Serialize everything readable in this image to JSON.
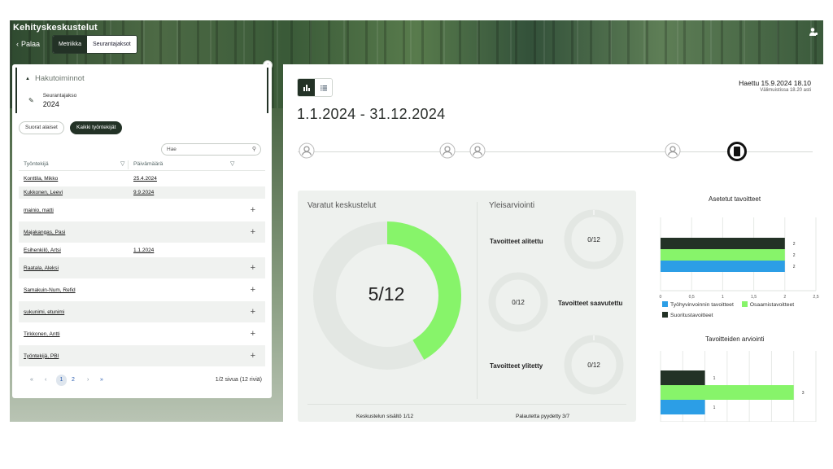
{
  "header": {
    "app_title": "Kehityskeskustelut",
    "back_label": "Palaa",
    "tabs": [
      {
        "label": "Metriikka",
        "active": true
      },
      {
        "label": "Seurantajaksot",
        "active": false
      }
    ],
    "user_icon": "user-icon"
  },
  "filters": {
    "title": "Hakutoiminnot",
    "period_label": "Seurantajakso",
    "period_value": "2024",
    "chips": [
      {
        "label": "Suorat alaiset",
        "active": false
      },
      {
        "label": "Kaikki työntekijät",
        "active": true
      }
    ],
    "search_placeholder": "Hae"
  },
  "table": {
    "columns": [
      "Työntekijä",
      "Päivämäärä"
    ],
    "rows": [
      {
        "name": "Konttila, Mikko",
        "date": "25.4.2024",
        "action": ""
      },
      {
        "name": "Kukkonen, Leevi",
        "date": "9.9.2024",
        "action": ""
      },
      {
        "name": "mainio, matti",
        "date": "",
        "action": "+"
      },
      {
        "name": "Majakangas, Pasi",
        "date": "",
        "action": "+"
      },
      {
        "name": "Esihenkilö, Artsi",
        "date": "1.1.2024",
        "action": ""
      },
      {
        "name": "Raatala, Aleksi",
        "date": "",
        "action": "+"
      },
      {
        "name": "Samakuin-Num, Refid",
        "date": "",
        "action": "+"
      },
      {
        "name": "sukunimi, etunimi",
        "date": "",
        "action": "+"
      },
      {
        "name": "Tirkkonen, Antti",
        "date": "",
        "action": "+"
      },
      {
        "name": "Työntekijä, PBI",
        "date": "",
        "action": "+"
      }
    ]
  },
  "pagination": {
    "first": "«",
    "prev": "‹",
    "page1": "1",
    "page2": "2",
    "next": "›",
    "last": "»",
    "info": "1/2 sivua (12 riviä)"
  },
  "main": {
    "fetched": "Haettu 15.9.2024 18.10",
    "cached": "Välimuistissa 18.20 asti",
    "period": "1.1.2024 - 31.12.2024"
  },
  "summary": {
    "booked_title": "Varatut keskustelut",
    "booked_value": "5/12",
    "booked_fraction": 0.4167,
    "overall_title": "Yleisarviointi",
    "items": [
      {
        "label": "Tavoitteet alitettu",
        "value": "0/12"
      },
      {
        "label": "Tavoitteet saavutettu",
        "value": "0/12"
      },
      {
        "label": "Tavoitteet ylitetty",
        "value": "0/12"
      }
    ],
    "footer_left": "Keskustelun sisältö 1/12",
    "footer_right": "Palautetta pyydetty 3/7"
  },
  "colors": {
    "dark": "#233226",
    "green": "#87f46a",
    "blue": "#2c9ee6",
    "ring": "#e3e7e3"
  },
  "chart_data": [
    {
      "type": "bar",
      "orientation": "horizontal",
      "title": "Asetetut tavoitteet",
      "series": [
        {
          "name": "Suoritustavoitteet",
          "values": [
            2
          ],
          "color": "#233226"
        },
        {
          "name": "Osaamistavoitteet",
          "values": [
            2
          ],
          "color": "#87f46a"
        },
        {
          "name": "Työhyvinvoinnin tavoitteet",
          "values": [
            2
          ],
          "color": "#2c9ee6"
        }
      ],
      "xlim": [
        0,
        2.5
      ],
      "xticks": [
        "0",
        "0,5",
        "1",
        "1,5",
        "2",
        "2,5"
      ],
      "legend": [
        "Työhyvinvoinnin tavoitteet",
        "Osaamistavoitteet",
        "Suoritustavoitteet"
      ]
    },
    {
      "type": "bar",
      "orientation": "horizontal",
      "title": "Tavoitteiden arviointi",
      "series": [
        {
          "values": [
            1
          ],
          "color": "#233226"
        },
        {
          "values": [
            3
          ],
          "color": "#87f46a"
        },
        {
          "values": [
            1
          ],
          "color": "#2c9ee6"
        }
      ],
      "xlim": [
        0,
        3.5
      ]
    }
  ]
}
